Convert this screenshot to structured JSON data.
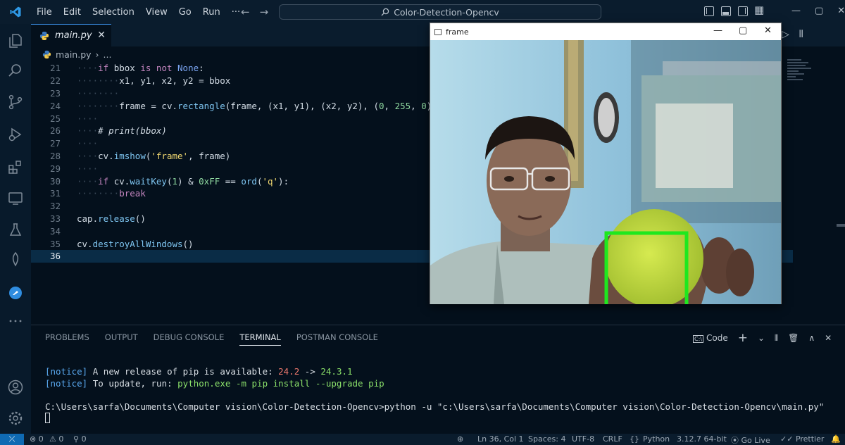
{
  "menu": [
    "File",
    "Edit",
    "Selection",
    "View",
    "Go",
    "Run",
    "···"
  ],
  "nav": {
    "back": "←",
    "forward": "→"
  },
  "search": {
    "text": "Color-Detection-Opencv"
  },
  "window_controls": [
    "—",
    "▢",
    "✕"
  ],
  "tab": {
    "label": "main.py",
    "close": "✕"
  },
  "editor_actions": [
    "▷",
    "⫴",
    "···"
  ],
  "breadcrumb": {
    "file": "main.py",
    "sep": "›",
    "rest": "..."
  },
  "code": {
    "active_line": "36"
  },
  "panel": {
    "tabs": [
      "PROBLEMS",
      "OUTPUT",
      "DEBUG CONSOLE",
      "TERMINAL",
      "POSTMAN CONSOLE"
    ],
    "active_tab": "TERMINAL",
    "profile_label": "Code",
    "actions": [
      "+",
      "⌄",
      "⫴",
      "🗑",
      "∧",
      "✕"
    ]
  },
  "terminal": {
    "line1_notice": "[notice]",
    "line1_text": " A new release of pip is available: ",
    "line1_old": "24.2",
    "line1_arrow": " -> ",
    "line1_new": "24.3.1",
    "line2_notice": "[notice]",
    "line2_text": " To update, run: ",
    "line2_cmd": "python.exe -m pip install --upgrade pip",
    "line3": "C:\\Users\\sarfa\\Documents\\Computer vision\\Color-Detection-Opencv>python -u \"c:\\Users\\sarfa\\Documents\\Computer vision\\Color-Detection-Opencv\\main.py\""
  },
  "status": {
    "errors": "⊗ 0",
    "warnings": "⚠ 0",
    "ports": "0",
    "zoom": "⊕",
    "position": "Ln 36, Col 1",
    "spaces": "Spaces: 4",
    "encoding": "UTF-8",
    "eol": "CRLF",
    "braces": "{}",
    "language": "Python",
    "interpreter": "3.12.7 64-bit",
    "golive": "Go Live",
    "prettier": "Prettier"
  },
  "frame_window": {
    "title": "frame",
    "controls": [
      "—",
      "▢",
      "✕"
    ]
  },
  "colors": {
    "accent": "#0f6ab3",
    "bbox": "#1ee81e",
    "background": "#04101c"
  }
}
